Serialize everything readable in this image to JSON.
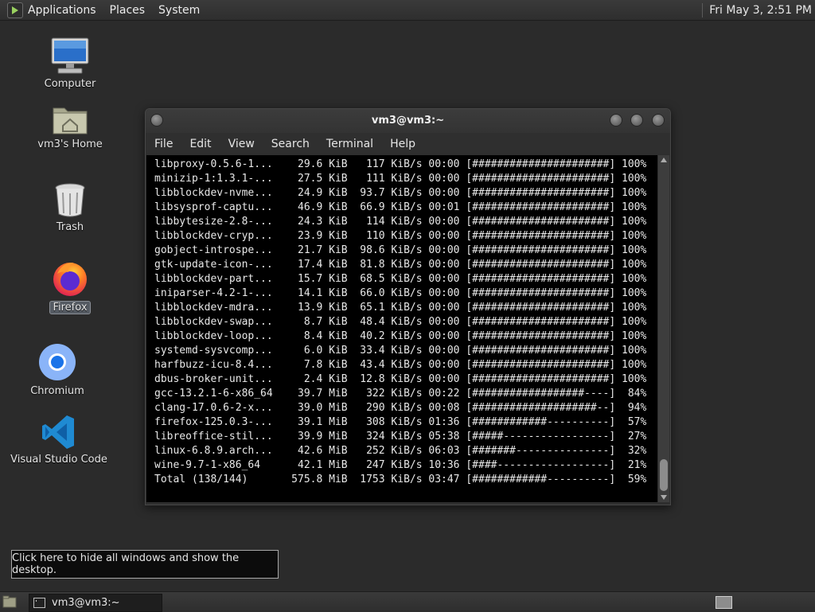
{
  "top_panel": {
    "menus": [
      "Applications",
      "Places",
      "System"
    ],
    "clock": "Fri May  3,  2:51 PM"
  },
  "desktop_icons": {
    "computer": "Computer",
    "home": "vm3's Home",
    "trash": "Trash",
    "firefox": "Firefox",
    "chromium": "Chromium",
    "vscode": "Visual Studio Code"
  },
  "terminal": {
    "title": "vm3@vm3:~",
    "menus": [
      "File",
      "Edit",
      "View",
      "Search",
      "Terminal",
      "Help"
    ],
    "lines": [
      "libproxy-0.5.6-1...    29.6 KiB   117 KiB/s 00:00 [######################] 100%",
      "minizip-1:1.3.1-...    27.5 KiB   111 KiB/s 00:00 [######################] 100%",
      "libblockdev-nvme...    24.9 KiB  93.7 KiB/s 00:00 [######################] 100%",
      "libsysprof-captu...    46.9 KiB  66.9 KiB/s 00:01 [######################] 100%",
      "libbytesize-2.8-...    24.3 KiB   114 KiB/s 00:00 [######################] 100%",
      "libblockdev-cryp...    23.9 KiB   110 KiB/s 00:00 [######################] 100%",
      "gobject-introspe...    21.7 KiB  98.6 KiB/s 00:00 [######################] 100%",
      "gtk-update-icon-...    17.4 KiB  81.8 KiB/s 00:00 [######################] 100%",
      "libblockdev-part...    15.7 KiB  68.5 KiB/s 00:00 [######################] 100%",
      "iniparser-4.2-1-...    14.1 KiB  66.0 KiB/s 00:00 [######################] 100%",
      "libblockdev-mdra...    13.9 KiB  65.1 KiB/s 00:00 [######################] 100%",
      "libblockdev-swap...     8.7 KiB  48.4 KiB/s 00:00 [######################] 100%",
      "libblockdev-loop...     8.4 KiB  40.2 KiB/s 00:00 [######################] 100%",
      "systemd-sysvcomp...     6.0 KiB  33.4 KiB/s 00:00 [######################] 100%",
      "harfbuzz-icu-8.4...     7.8 KiB  43.4 KiB/s 00:00 [######################] 100%",
      "dbus-broker-unit...     2.4 KiB  12.8 KiB/s 00:00 [######################] 100%",
      "gcc-13.2.1-6-x86_64    39.7 MiB   322 KiB/s 00:22 [##################----]  84%",
      "clang-17.0.6-2-x...    39.0 MiB   290 KiB/s 00:08 [####################--]  94%",
      "firefox-125.0.3-...    39.1 MiB   308 KiB/s 01:36 [############----------]  57%",
      "libreoffice-stil...    39.9 MiB   324 KiB/s 05:38 [#####-----------------]  27%",
      "linux-6.8.9.arch...    42.6 MiB   252 KiB/s 06:03 [#######---------------]  32%",
      "wine-9.7-1-x86_64      42.1 MiB   247 KiB/s 10:36 [####------------------]  21%",
      "Total (138/144)       575.8 MiB  1753 KiB/s 03:47 [############----------]  59%"
    ]
  },
  "tooltip": "Click here to hide all windows and show the desktop.",
  "taskbar": {
    "window_title": "vm3@vm3:~"
  }
}
